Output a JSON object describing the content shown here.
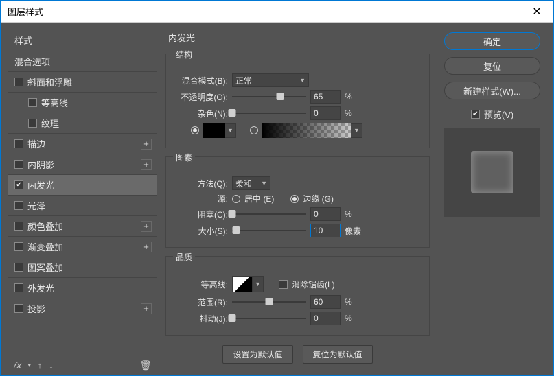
{
  "title": "图层样式",
  "styles_header": "样式",
  "blend_options": "混合选项",
  "effects": {
    "bevel": "斜面和浮雕",
    "contour_sub": "等高线",
    "texture_sub": "纹理",
    "stroke": "描边",
    "inner_shadow": "内阴影",
    "inner_glow": "内发光",
    "satin": "光泽",
    "color_overlay": "颜色叠加",
    "gradient_overlay": "渐变叠加",
    "pattern_overlay": "图案叠加",
    "outer_glow": "外发光",
    "drop_shadow": "投影"
  },
  "panel": {
    "title": "内发光",
    "structure": {
      "legend": "结构",
      "blend_mode_label": "混合模式(B):",
      "blend_mode_value": "正常",
      "opacity_label": "不透明度(O):",
      "opacity_value": "65",
      "opacity_unit": "%",
      "noise_label": "杂色(N):",
      "noise_value": "0",
      "noise_unit": "%"
    },
    "elements": {
      "legend": "图素",
      "technique_label": "方法(Q):",
      "technique_value": "柔和",
      "source_label": "源:",
      "center_label": "居中 (E)",
      "edge_label": "边缘 (G)",
      "choke_label": "阻塞(C):",
      "choke_value": "0",
      "choke_unit": "%",
      "size_label": "大小(S):",
      "size_value": "10",
      "size_unit": "像素"
    },
    "quality": {
      "legend": "品质",
      "contour_label": "等高线:",
      "antialias_label": "消除锯齿(L)",
      "range_label": "范围(R):",
      "range_value": "60",
      "range_unit": "%",
      "jitter_label": "抖动(J):",
      "jitter_value": "0",
      "jitter_unit": "%"
    },
    "btn_default": "设置为默认值",
    "btn_reset": "复位为默认值"
  },
  "actions": {
    "ok": "确定",
    "reset": "复位",
    "new_style": "新建样式(W)...",
    "preview": "预览(V)"
  },
  "footer": {
    "fx": "𝑓𝗑"
  }
}
